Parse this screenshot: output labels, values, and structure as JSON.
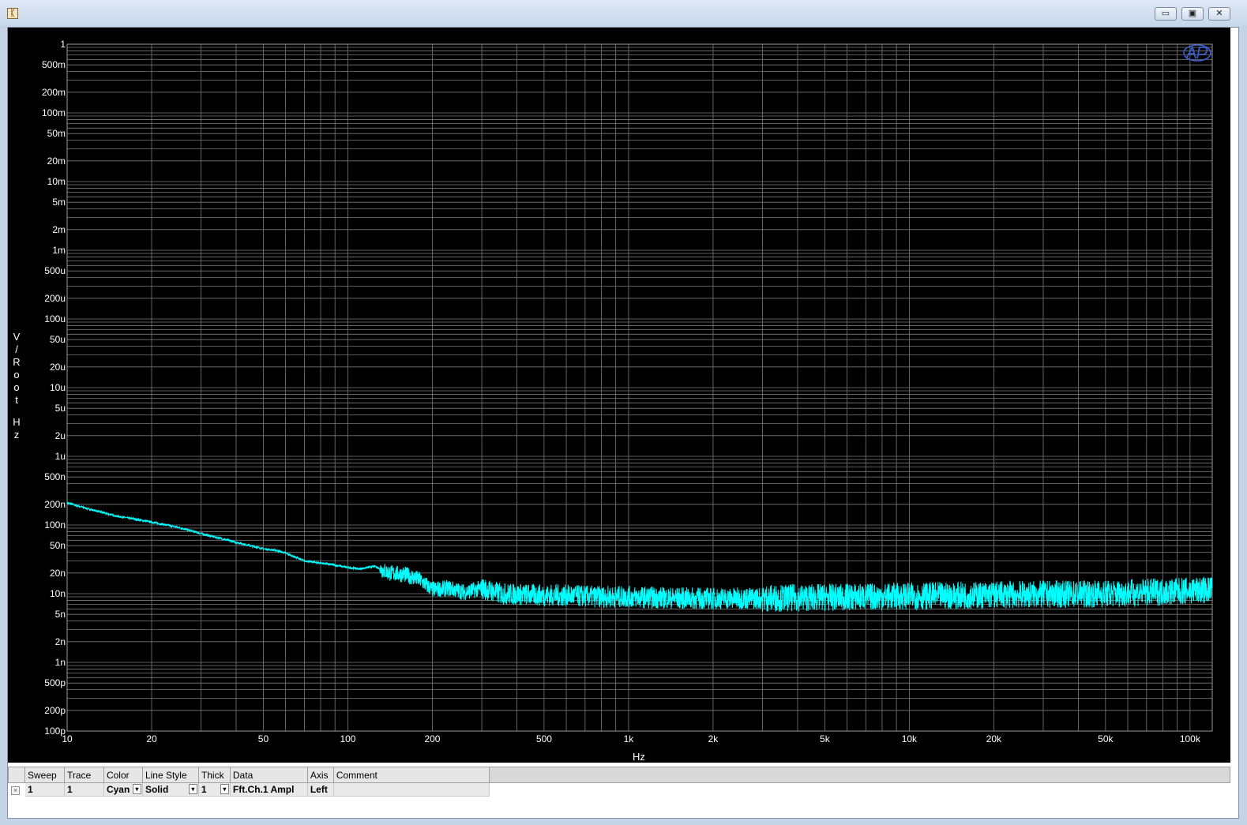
{
  "window": {
    "icon": "app-logo-icon",
    "minimize_glyph": "▭",
    "maximize_glyph": "▣",
    "close_glyph": "✕"
  },
  "chart_data": {
    "type": "line",
    "scale": {
      "x": "log",
      "y": "log"
    },
    "xlabel": "Hz",
    "ylabel": "V/Root Hz",
    "xlim": [
      10,
      120000
    ],
    "ylim": [
      1e-10,
      1
    ],
    "x_ticks": [
      {
        "v": 10,
        "label": "10"
      },
      {
        "v": 20,
        "label": "20"
      },
      {
        "v": 50,
        "label": "50"
      },
      {
        "v": 100,
        "label": "100"
      },
      {
        "v": 200,
        "label": "200"
      },
      {
        "v": 500,
        "label": "500"
      },
      {
        "v": 1000,
        "label": "1k"
      },
      {
        "v": 2000,
        "label": "2k"
      },
      {
        "v": 5000,
        "label": "5k"
      },
      {
        "v": 10000,
        "label": "10k"
      },
      {
        "v": 20000,
        "label": "20k"
      },
      {
        "v": 50000,
        "label": "50k"
      },
      {
        "v": 100000,
        "label": "100k"
      }
    ],
    "y_ticks": [
      {
        "v": 1,
        "label": "1"
      },
      {
        "v": 0.5,
        "label": "500m"
      },
      {
        "v": 0.2,
        "label": "200m"
      },
      {
        "v": 0.1,
        "label": "100m"
      },
      {
        "v": 0.05,
        "label": "50m"
      },
      {
        "v": 0.02,
        "label": "20m"
      },
      {
        "v": 0.01,
        "label": "10m"
      },
      {
        "v": 0.005,
        "label": "5m"
      },
      {
        "v": 0.002,
        "label": "2m"
      },
      {
        "v": 0.001,
        "label": "1m"
      },
      {
        "v": 0.0005,
        "label": "500u"
      },
      {
        "v": 0.0002,
        "label": "200u"
      },
      {
        "v": 0.0001,
        "label": "100u"
      },
      {
        "v": 5e-05,
        "label": "50u"
      },
      {
        "v": 2e-05,
        "label": "20u"
      },
      {
        "v": 1e-05,
        "label": "10u"
      },
      {
        "v": 5e-06,
        "label": "5u"
      },
      {
        "v": 2e-06,
        "label": "2u"
      },
      {
        "v": 1e-06,
        "label": "1u"
      },
      {
        "v": 5e-07,
        "label": "500n"
      },
      {
        "v": 2e-07,
        "label": "200n"
      },
      {
        "v": 1e-07,
        "label": "100n"
      },
      {
        "v": 5e-08,
        "label": "50n"
      },
      {
        "v": 2e-08,
        "label": "20n"
      },
      {
        "v": 1e-08,
        "label": "10n"
      },
      {
        "v": 5e-09,
        "label": "5n"
      },
      {
        "v": 2e-09,
        "label": "2n"
      },
      {
        "v": 1e-09,
        "label": "1n"
      },
      {
        "v": 5e-10,
        "label": "500p"
      },
      {
        "v": 2e-10,
        "label": "200p"
      },
      {
        "v": 1e-10,
        "label": "100p"
      }
    ],
    "grid": true,
    "background": "#000000",
    "grid_color": "#7a7a7a",
    "text_color": "#ffffff",
    "series": [
      {
        "color": "#00ffff",
        "x": [
          10,
          12,
          15,
          20,
          25,
          30,
          40,
          50,
          55,
          60,
          70,
          80,
          90,
          100,
          110,
          125,
          140,
          160,
          180,
          200,
          230,
          260,
          300,
          350,
          400,
          500,
          600,
          700,
          800,
          1000,
          1500,
          2000,
          3000,
          5000,
          7000,
          10000,
          15000,
          20000,
          30000,
          50000,
          70000,
          100000,
          120000
        ],
        "y": [
          2.1e-07,
          1.7e-07,
          1.35e-07,
          1.1e-07,
          9.2e-08,
          7.5e-08,
          5.6e-08,
          4.5e-08,
          4.3e-08,
          3.9e-08,
          3e-08,
          2.8e-08,
          2.6e-08,
          2.4e-08,
          2.3e-08,
          2.5e-08,
          2e-08,
          1.9e-08,
          1.6e-08,
          1.15e-08,
          1.2e-08,
          1.05e-08,
          1.2e-08,
          1e-08,
          9.8e-09,
          9.5e-09,
          9.4e-09,
          9.2e-09,
          9e-09,
          9e-09,
          8.6e-09,
          8.5e-09,
          8.6e-09,
          8.8e-09,
          9e-09,
          9.2e-09,
          9.4e-09,
          9.6e-09,
          9.8e-09,
          1e-08,
          1.05e-08,
          1.1e-08,
          1.15e-08
        ]
      }
    ]
  },
  "legend": {
    "headers": [
      "Sweep",
      "Trace",
      "Color",
      "Line Style",
      "Thick",
      "Data",
      "Axis",
      "Comment"
    ],
    "rows": [
      {
        "checked_glyph": "×",
        "sweep": "1",
        "trace": "1",
        "color": "Cyan",
        "line_style": "Solid",
        "thick": "1",
        "data": "Fft.Ch.1 Ampl",
        "axis": "Left",
        "comment": ""
      }
    ],
    "dropdown_glyph": "▾"
  }
}
